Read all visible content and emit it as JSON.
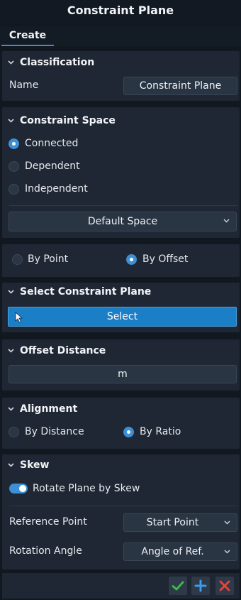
{
  "window": {
    "title": "Constraint Plane"
  },
  "tabs": [
    {
      "label": "Create"
    }
  ],
  "classification": {
    "header": "Classification",
    "name_label": "Name",
    "name_value": "Constraint Plane"
  },
  "constraint_space": {
    "header": "Constraint Space",
    "options": [
      {
        "label": "Connected",
        "selected": true
      },
      {
        "label": "Dependent",
        "selected": false
      },
      {
        "label": "Independent",
        "selected": false
      }
    ],
    "space_dropdown": "Default Space"
  },
  "mode": {
    "options": [
      {
        "label": "By Point",
        "selected": false
      },
      {
        "label": "By Offset",
        "selected": true
      }
    ]
  },
  "select_plane": {
    "header": "Select Constraint Plane",
    "button_label": "Select"
  },
  "offset": {
    "header": "Offset Distance",
    "value": "m"
  },
  "alignment": {
    "header": "Alignment",
    "options": [
      {
        "label": "By Distance",
        "selected": false
      },
      {
        "label": "By Ratio",
        "selected": true
      }
    ]
  },
  "skew": {
    "header": "Skew",
    "toggle_label": "Rotate Plane by Skew",
    "toggle_on": true,
    "reference_label": "Reference Point",
    "reference_value": "Start Point",
    "rotation_label": "Rotation Angle",
    "rotation_value": "Angle of Ref."
  },
  "footer": {
    "ok_icon": "check-icon",
    "add_icon": "plus-icon",
    "cancel_icon": "close-icon"
  },
  "colors": {
    "accent": "#1b7fc8",
    "panel": "#1e2733",
    "background": "#111820",
    "ok": "#3fbf4a",
    "add": "#3d9be9",
    "cancel": "#e8453c"
  }
}
